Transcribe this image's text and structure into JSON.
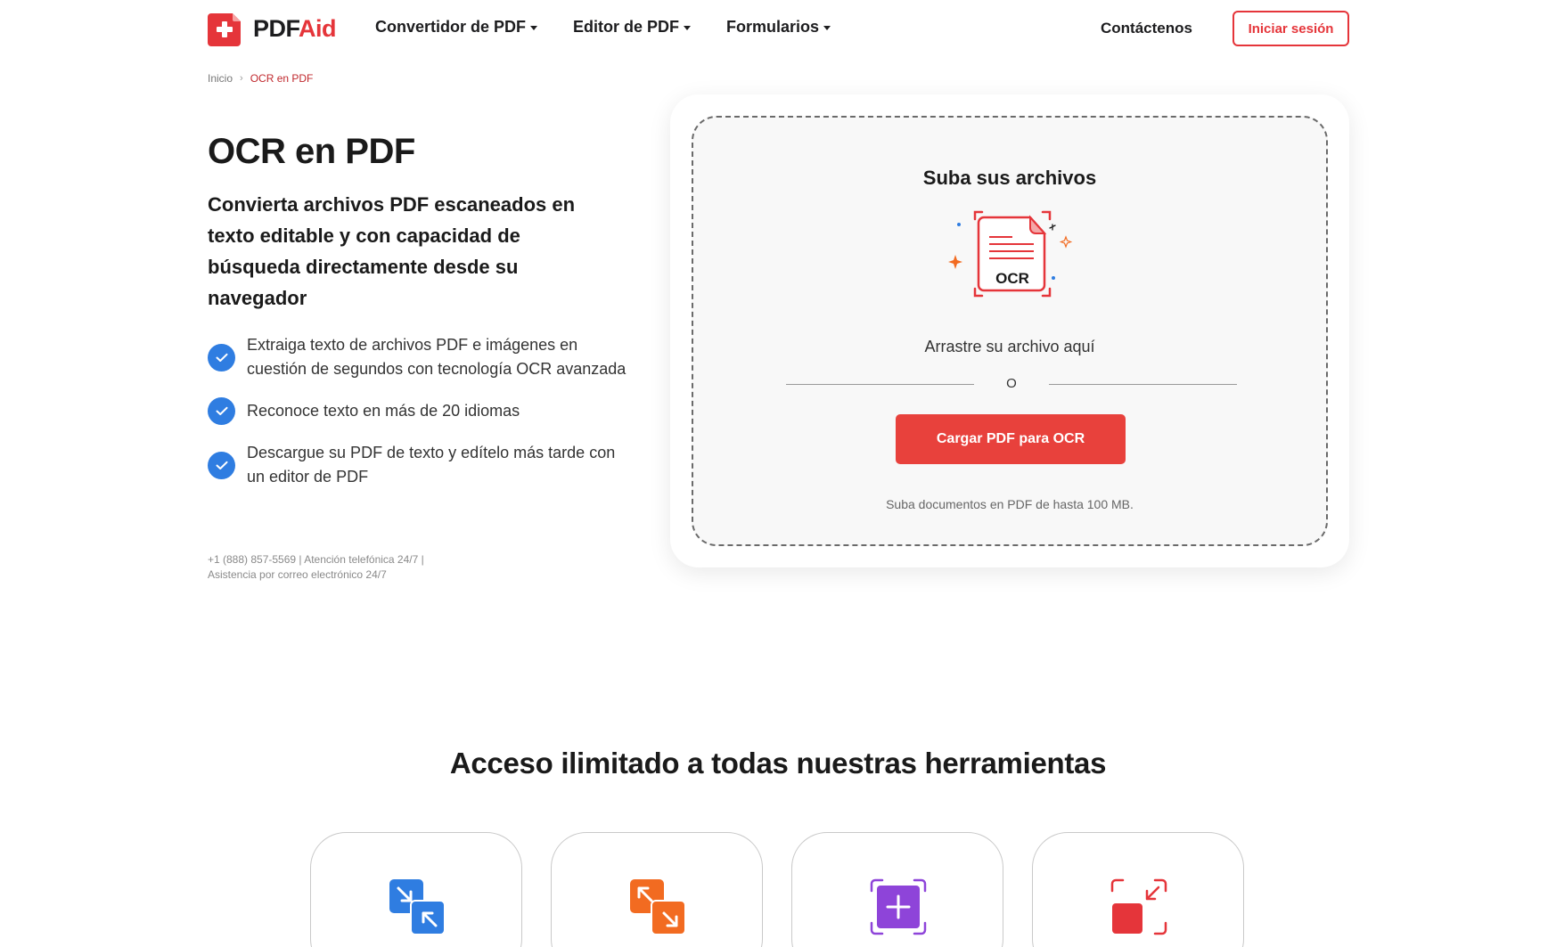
{
  "header": {
    "logo_part1": "PDF",
    "logo_part2": "Aid",
    "nav": [
      {
        "label": "Convertidor de PDF"
      },
      {
        "label": "Editor de PDF"
      },
      {
        "label": "Formularios"
      }
    ],
    "contact_label": "Contáctenos",
    "login_label": "Iniciar sesión"
  },
  "breadcrumb": {
    "home": "Inicio",
    "current": "OCR en PDF"
  },
  "hero": {
    "title": "OCR en PDF",
    "subtitle": "Convierta archivos PDF escaneados en texto editable y con capacidad de búsqueda directamente desde su navegador",
    "features": [
      "Extraiga texto de archivos PDF e imágenes en cuestión de segundos con tecnología OCR avanzada",
      "Reconoce texto en más de 20 idiomas",
      "Descargue su PDF de texto y edítelo más tarde con un editor de PDF"
    ],
    "support_line1": "+1 (888) 857-5569 | Atención telefónica 24/7 |",
    "support_line2": "Asistencia por correo electrónico 24/7"
  },
  "upload": {
    "title": "Suba sus archivos",
    "illustration_label": "OCR",
    "drag_text": "Arrastre su archivo aquí",
    "or_text": "O",
    "button_label": "Cargar PDF para OCR",
    "note": "Suba documentos en PDF de hasta 100 MB."
  },
  "tools_section": {
    "title": "Acceso ilimitado a todas nuestras herramientas",
    "cards": [
      {
        "icon": "compress-arrows-icon",
        "color": "#2f7de1"
      },
      {
        "icon": "expand-arrows-icon",
        "color": "#f26b21"
      },
      {
        "icon": "add-plus-icon",
        "color": "#8e44d9"
      },
      {
        "icon": "shrink-square-icon",
        "color": "#e5353a"
      }
    ]
  },
  "colors": {
    "brand_red": "#e5353a",
    "button_red": "#e8413c",
    "check_blue": "#2f7de1"
  }
}
